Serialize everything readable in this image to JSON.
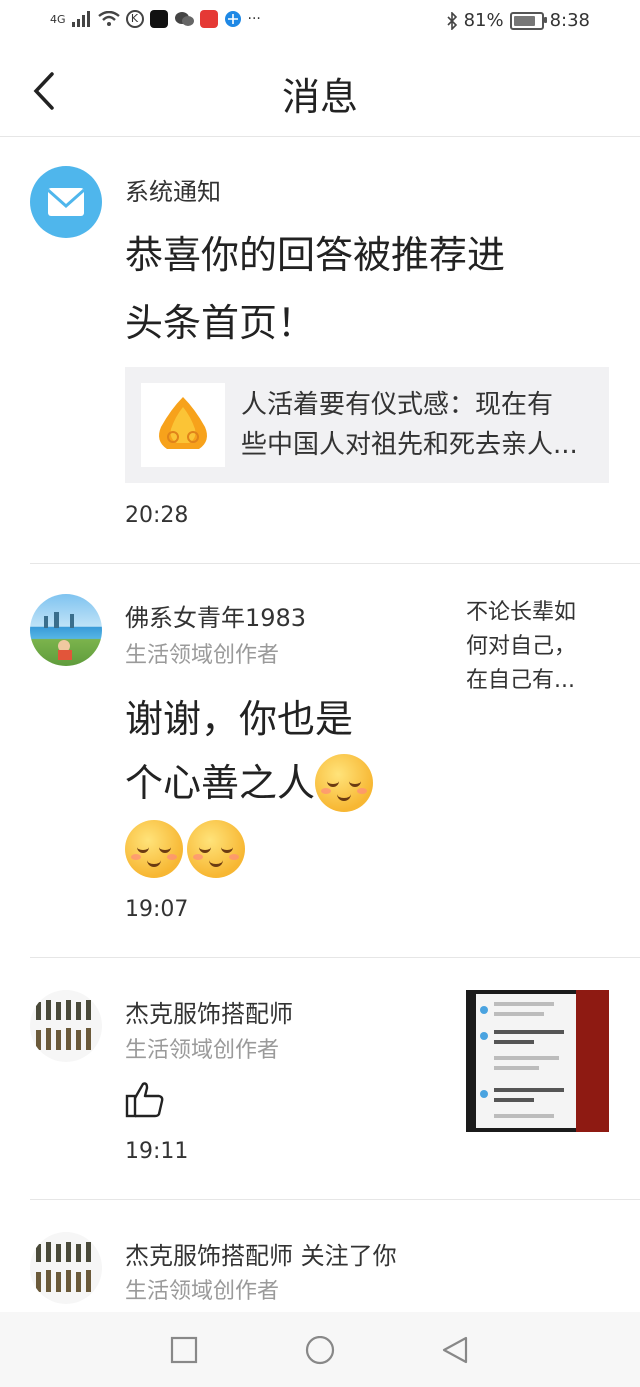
{
  "status_bar": {
    "signal": "4G",
    "battery_percent": "81%",
    "battery_level": 0.81,
    "time": "8:38",
    "more": "···"
  },
  "header": {
    "title": "消息"
  },
  "messages": [
    {
      "sender": "系统通知",
      "text_line1": "恭喜你的回答被推荐进",
      "text_line2": "头条首页！",
      "card_line1": "人活着要有仪式感：现在有",
      "card_line2": "些中国人对祖先和死去亲人...",
      "time": "20:28"
    },
    {
      "sender": "佛系女青年1983",
      "role": "生活领域创作者",
      "text_line1": "谢谢，你也是",
      "text_line2": "个心善之人",
      "side_line1": "不论长辈如",
      "side_line2": "何对自己，",
      "side_line3": "在自己有...",
      "time": "19:07"
    },
    {
      "sender": "杰克服饰搭配师",
      "role": "生活领域创作者",
      "time": "19:11"
    },
    {
      "sender": "杰克服饰搭配师 关注了你",
      "role": "生活领域创作者"
    }
  ],
  "colors": {
    "system_avatar": "#4fb6ec",
    "divider": "#e6e6e6",
    "secondary_text": "#9a9a9a"
  }
}
